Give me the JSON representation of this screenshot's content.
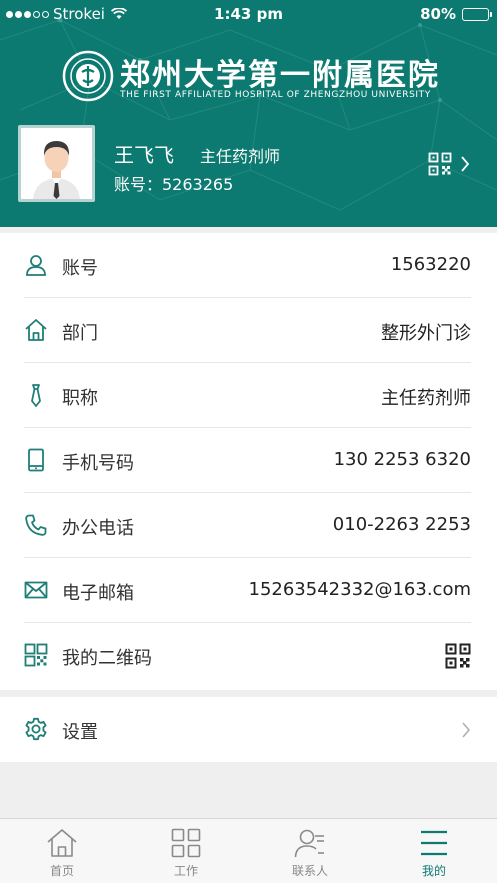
{
  "status_bar": {
    "carrier": "Strokei",
    "time": "1:43 pm",
    "battery": "80%",
    "battery_level": 0.8
  },
  "header": {
    "hospital_name_cn": "郑州大学第一附属医院",
    "hospital_name_en": "THE FIRST AFFILIATED HOSPITAL OF ZHENGZHOU UNIVERSITY"
  },
  "profile": {
    "name": "王飞飞",
    "title": "主任药剂师",
    "account_line": "账号：5263265"
  },
  "info_rows": [
    {
      "icon": "user-icon",
      "label": "账号",
      "value": "1563220"
    },
    {
      "icon": "home-icon",
      "label": "部门",
      "value": "整形外门诊"
    },
    {
      "icon": "tie-icon",
      "label": "职称",
      "value": "主任药剂师"
    },
    {
      "icon": "mobile-phone-icon",
      "label": "手机号码",
      "value": "130 2253 6320"
    },
    {
      "icon": "telephone-icon",
      "label": "办公电话",
      "value": "010-2263 2253"
    },
    {
      "icon": "mail-icon",
      "label": "电子邮箱",
      "value": "15263542332@163.com"
    },
    {
      "icon": "qrcode-icon",
      "label": "我的二维码",
      "value": ""
    }
  ],
  "settings": {
    "icon": "gear-icon",
    "label": "设置"
  },
  "tabbar": {
    "active": "我的",
    "tabs": [
      {
        "icon": "home-tab-icon",
        "label": "首页"
      },
      {
        "icon": "grid-tab-icon",
        "label": "工作"
      },
      {
        "icon": "contacts-tab-icon",
        "label": "联系人"
      },
      {
        "icon": "menu-tab-icon",
        "label": "我的"
      }
    ]
  },
  "colors": {
    "brand": "#0c7a70",
    "icon": "#1f7f76",
    "background": "#efefef"
  }
}
